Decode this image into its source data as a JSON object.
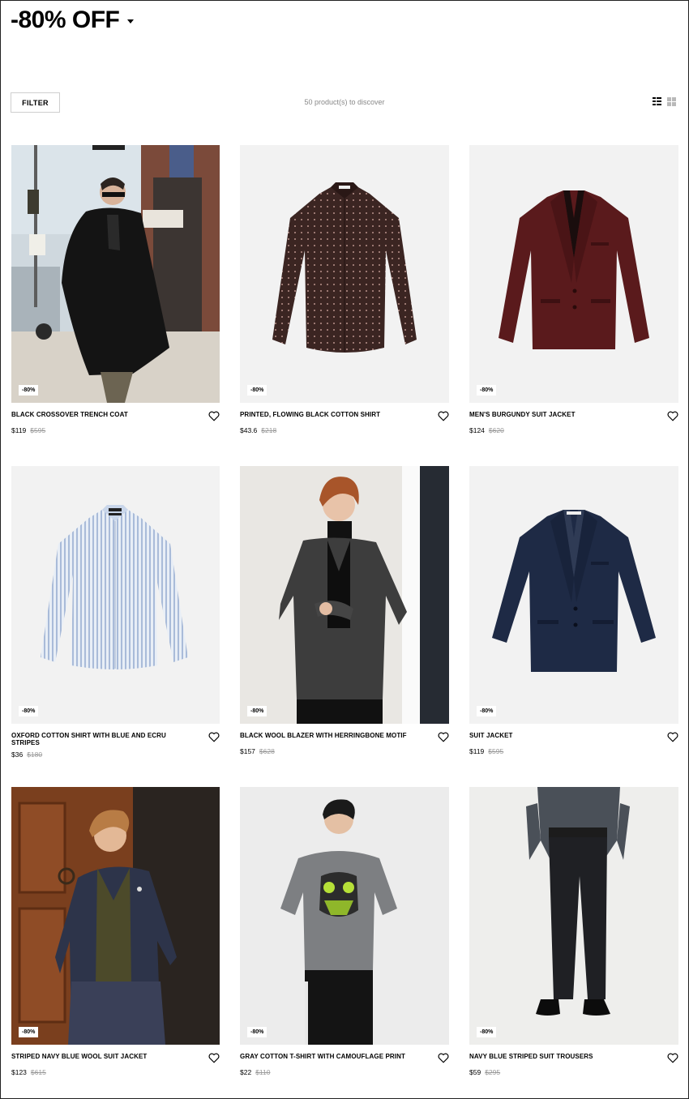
{
  "header": {
    "title": "-80% OFF",
    "filter_label": "FILTER",
    "product_count": "50 product(s) to discover"
  },
  "icons": {
    "dropdown": "caret-down-icon",
    "list_view": "list-view-icon",
    "grid_view": "grid-view-icon",
    "wishlist": "heart-icon"
  },
  "products": [
    {
      "name": "BLACK CROSSOVER TRENCH COAT",
      "price": "$119",
      "old_price": "$595",
      "badge": "-80%"
    },
    {
      "name": "PRINTED, FLOWING BLACK COTTON SHIRT",
      "price": "$43.6",
      "old_price": "$218",
      "badge": "-80%"
    },
    {
      "name": "MEN'S BURGUNDY SUIT JACKET",
      "price": "$124",
      "old_price": "$620",
      "badge": "-80%"
    },
    {
      "name": "OXFORD COTTON SHIRT WITH BLUE AND ECRU STRIPES",
      "price": "$36",
      "old_price": "$180",
      "badge": "-80%"
    },
    {
      "name": "BLACK WOOL BLAZER WITH HERRINGBONE MOTIF",
      "price": "$157",
      "old_price": "$628",
      "badge": "-80%"
    },
    {
      "name": "SUIT JACKET",
      "price": "$119",
      "old_price": "$595",
      "badge": "-80%"
    },
    {
      "name": "STRIPED NAVY BLUE WOOL SUIT JACKET",
      "price": "$123",
      "old_price": "$615",
      "badge": "-80%"
    },
    {
      "name": "GRAY COTTON T-SHIRT WITH CAMOUFLAGE PRINT",
      "price": "$22",
      "old_price": "$110",
      "badge": "-80%"
    },
    {
      "name": "NAVY BLUE STRIPED SUIT TROUSERS",
      "price": "$59",
      "old_price": "$295",
      "badge": "-80%"
    }
  ]
}
